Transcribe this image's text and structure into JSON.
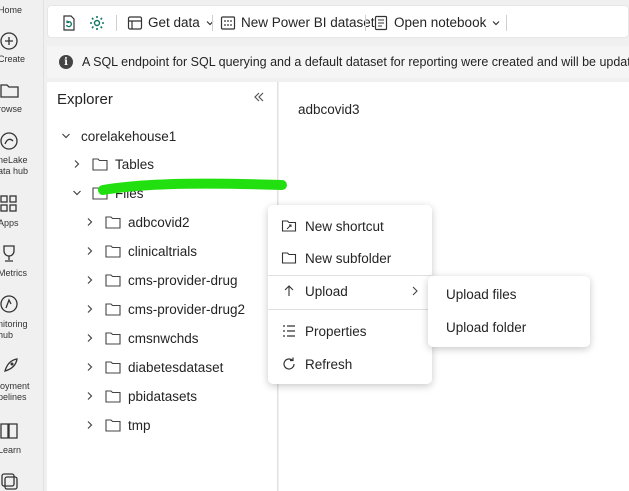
{
  "rail": {
    "items": [
      {
        "label": "Home"
      },
      {
        "label": "Create"
      },
      {
        "label": "rowse"
      },
      {
        "label": "neLake",
        "label2": "ata hub"
      },
      {
        "label": "Apps"
      },
      {
        "label": "Metrics"
      },
      {
        "label": "nitoring",
        "label2": "hub"
      },
      {
        "label": "loyment",
        "label2": "pelines"
      },
      {
        "label": "Learn"
      }
    ]
  },
  "toolbar": {
    "get_data": "Get data",
    "new_dataset": "New Power BI dataset",
    "open_notebook": "Open notebook"
  },
  "infobar": {
    "message": "A SQL endpoint for SQL querying and a default dataset for reporting were created and will be updated with any tab"
  },
  "explorer": {
    "title": "Explorer",
    "root": "corelakehouse1",
    "tables": "Tables",
    "files": "Files",
    "folders": [
      "adbcovid2",
      "clinicaltrials",
      "cms-provider-drug",
      "cms-provider-drug2",
      "cmsnwchds",
      "diabetesdataset",
      "pbidatasets",
      "tmp"
    ]
  },
  "main": {
    "title": "adbcovid3"
  },
  "context_menu": {
    "new_shortcut": "New shortcut",
    "new_subfolder": "New subfolder",
    "upload": "Upload",
    "properties": "Properties",
    "refresh": "Refresh"
  },
  "submenu": {
    "upload_files": "Upload files",
    "upload_folder": "Upload folder"
  },
  "colors": {
    "highlight": "#22e010",
    "accent": "#117865"
  }
}
